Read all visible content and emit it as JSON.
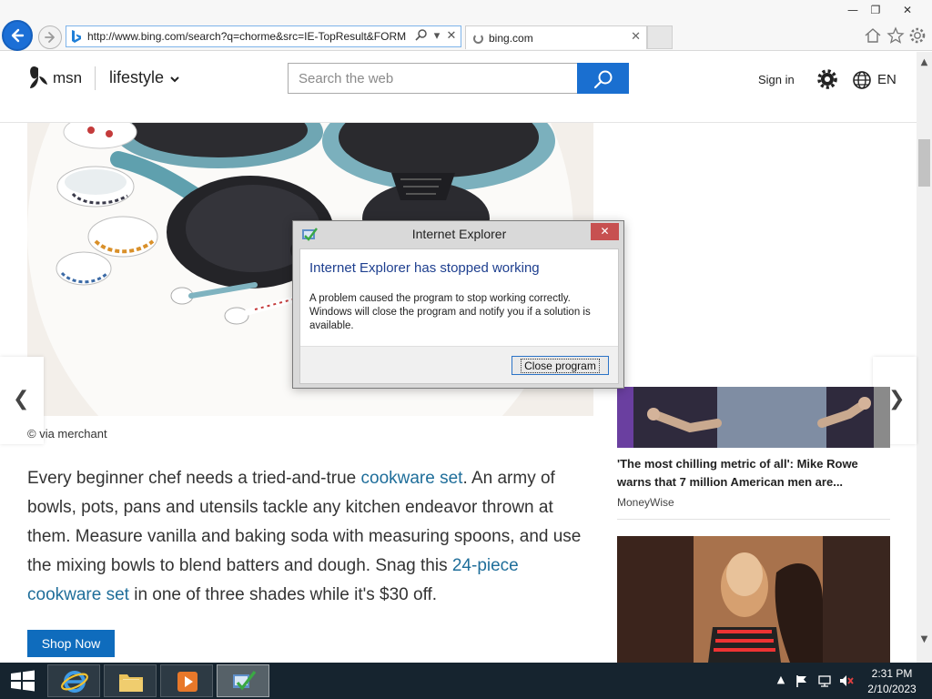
{
  "browser": {
    "address_url": "http://www.bing.com/search?q=chorme&src=IE-TopResult&FORM",
    "tab_label": "bing.com",
    "tab_close": "✕"
  },
  "header": {
    "logo_text": "msn",
    "section_label": "lifestyle",
    "search_placeholder": "Search the web",
    "sign_in_label": "Sign in",
    "language_label": "EN"
  },
  "content": {
    "image_credit": "© via merchant",
    "article": {
      "text_1": "Every beginner chef needs a tried-and-true ",
      "link_1": "cookware set",
      "text_2": ". An army of bowls, pots, pans and utensils tackle any kitchen endeavor thrown at them. Measure vanilla and baking soda with measuring spoons, and use the mixing bowls to blend batters and dough. Snag this ",
      "link_2": "24-piece cookware set",
      "text_3": " in one of three shades while it's $30 off."
    },
    "shop_now_label": "Shop Now",
    "sidebar_card_1": {
      "title": "'The most chilling metric of all': Mike Rowe warns that 7 million American men are...",
      "source": "MoneyWise"
    }
  },
  "dialog": {
    "title": "Internet Explorer",
    "heading": "Internet Explorer has stopped working",
    "message": "A problem caused the program to stop working correctly. Windows will close the program and notify you if a solution is available.",
    "button_label": "Close program",
    "close_glyph": "✕"
  },
  "taskbar": {
    "time": "2:31 PM",
    "date": "2/10/2023"
  },
  "colors": {
    "accent": "#1a6fd0",
    "link": "#1f6e9a",
    "dialog_heading": "#1e3f8f",
    "taskbar": "#16242f"
  }
}
